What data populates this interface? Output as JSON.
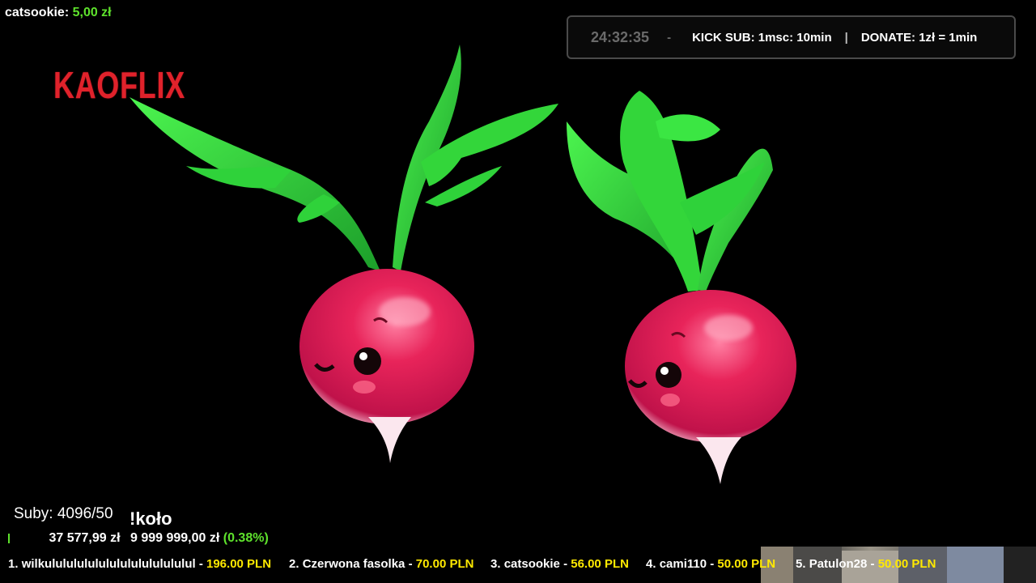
{
  "last_donation": {
    "user": "catsookie:",
    "amount": "5,00 zł"
  },
  "logo": {
    "text": "KAOFLIX"
  },
  "timer_bar": {
    "time": "24:32:35",
    "dash": "-",
    "kick_sub": "KICK SUB: 1msc: 10min",
    "pipe": "|",
    "donate": "DONATE: 1zł = 1min"
  },
  "subs": {
    "label": "Suby: 4096/50",
    "wheel_cmd": "!koło"
  },
  "goal": {
    "current": "37 577,99 zł",
    "target": "9 999 999,00 zł",
    "percent": "(0.38%)",
    "progress": 0.0038
  },
  "ticker": [
    {
      "rank": "1.",
      "name": "wilkulululululululululululululul",
      "sep": "-",
      "amount": "196.00 PLN"
    },
    {
      "rank": "2.",
      "name": "Czerwona fasolka",
      "sep": "-",
      "amount": "70.00 PLN"
    },
    {
      "rank": "3.",
      "name": "catsookie",
      "sep": "-",
      "amount": "56.00 PLN"
    },
    {
      "rank": "4.",
      "name": "cami110",
      "sep": "-",
      "amount": "50.00 PLN"
    },
    {
      "rank": "5.",
      "name": "Patulon28",
      "sep": "-",
      "amount": "50.00 PLN"
    }
  ],
  "colors": {
    "accent_green": "#5ee22c",
    "ticker_amount": "#ffe900",
    "logo_red": "#e0222b",
    "radish": "#e8245a",
    "leaf": "#33d63a"
  }
}
